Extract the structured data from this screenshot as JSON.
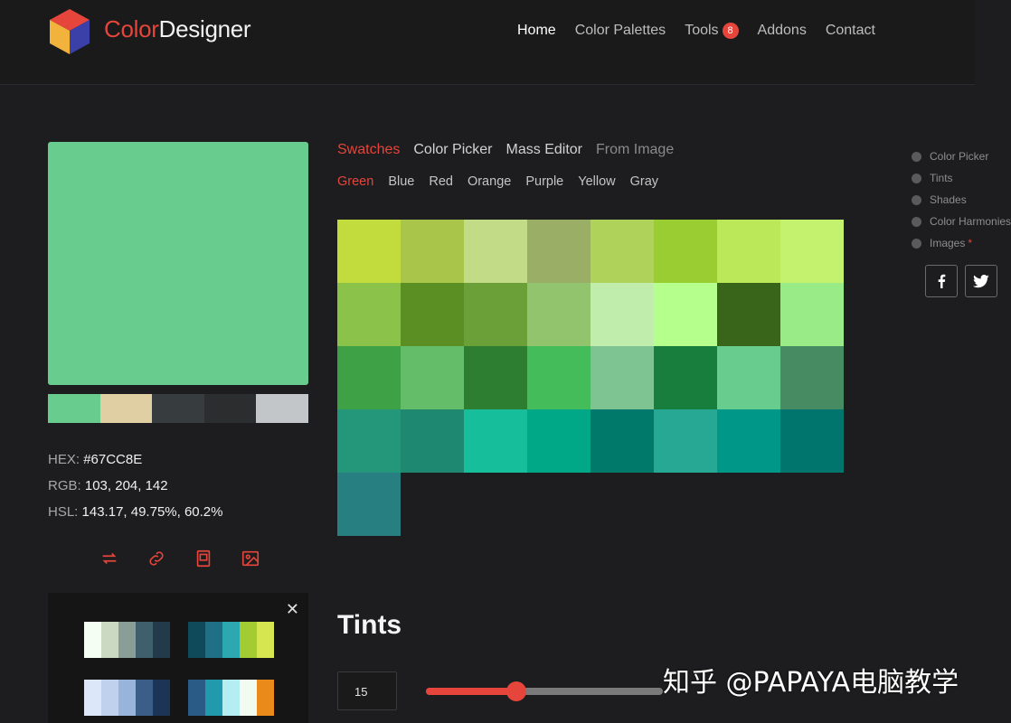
{
  "brand": {
    "part1": "Color",
    "part2": "Designer"
  },
  "nav": {
    "home": "Home",
    "palettes": "Color Palettes",
    "tools": "Tools",
    "tools_badge": "8",
    "addons": "Addons",
    "contact": "Contact"
  },
  "color": {
    "main": "#67CC8E",
    "hex_label": "HEX:",
    "hex": "#67CC8E",
    "rgb_label": "RGB:",
    "rgb": "103, 204, 142",
    "hsl_label": "HSL:",
    "hsl": "143.17, 49.75%, 60.2%"
  },
  "palette_strip": [
    "#67CC8E",
    "#E1CFA4",
    "#373D3E",
    "#2B2D2E",
    "#C3C6C9"
  ],
  "actions": [
    "swap-icon",
    "link-icon",
    "save-icon",
    "image-icon"
  ],
  "saved_palettes": [
    [
      "#F4FEF2",
      "#CCD9C2",
      "#8A9D96",
      "#3F5F6D",
      "#233A4A"
    ],
    [
      "#0E4A5A",
      "#1F7086",
      "#2EA8B0",
      "#A2CC32",
      "#D6E650"
    ],
    [
      "#DDE7FA",
      "#BFD1EC",
      "#98B4DA",
      "#3B5E88",
      "#1C3556"
    ],
    [
      "#2A5A86",
      "#229AAE",
      "#B4EEF2",
      "#F2FBEF",
      "#EA8A1A"
    ]
  ],
  "tabs": {
    "swatches": "Swatches",
    "picker": "Color Picker",
    "mass": "Mass Editor",
    "image": "From Image"
  },
  "subtabs": [
    "Green",
    "Blue",
    "Red",
    "Orange",
    "Purple",
    "Yellow",
    "Gray"
  ],
  "swatches": [
    "#C3DC3D",
    "#A9C64A",
    "#C2DB86",
    "#9BAE66",
    "#AFD35A",
    "#9ACD32",
    "#BBE858",
    "#C4F26E",
    "#8BC34A",
    "#5B8E23",
    "#6B9F37",
    "#91C46C",
    "#C0ECAC",
    "#B5FF8D",
    "#39651B",
    "#98EB86",
    "#3FA146",
    "#64BD68",
    "#2E7E31",
    "#44BC59",
    "#7EC493",
    "#177E3D",
    "#67CC8E",
    "#478B63",
    "#24977A",
    "#1F8870",
    "#17BE9C",
    "#00A888",
    "#00796B",
    "#27A895",
    "#009688",
    "#00756D",
    "#287F82"
  ],
  "tints": {
    "title": "Tints",
    "value": "15",
    "slider_fraction": 0.38
  },
  "sidenav": {
    "picker": "Color Picker",
    "tints": "Tints",
    "shades": "Shades",
    "harmonies": "Color Harmonies",
    "images": "Images",
    "images_mark": "*"
  },
  "watermark": "知乎 @PAPAYA电脑教学"
}
